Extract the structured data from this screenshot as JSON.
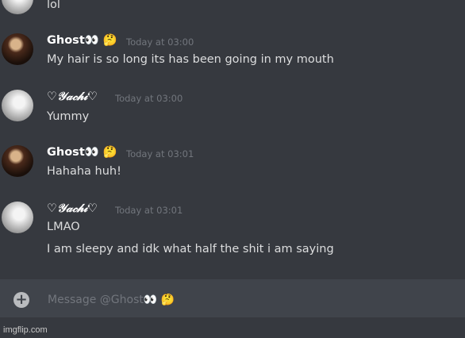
{
  "top_partial": {
    "text": "lol"
  },
  "messages": [
    {
      "username": "Ghost👀 🤔",
      "timestamp": "Today at 03:00",
      "lines": [
        "My hair is so long its has been going in my mouth"
      ]
    },
    {
      "username": "♡𝒴𝒶𝒸𝒽𝒾♡",
      "timestamp": "Today at 03:00",
      "lines": [
        "Yummy"
      ]
    },
    {
      "username": "Ghost👀 🤔",
      "timestamp": "Today at 03:01",
      "lines": [
        "Hahaha huh!"
      ]
    },
    {
      "username": "♡𝒴𝒶𝒸𝒽𝒾♡",
      "timestamp": "Today at 03:01",
      "lines": [
        "LMAO",
        "I am sleepy and idk what half the shit i am saying"
      ]
    }
  ],
  "composer": {
    "placeholder": "Message @Ghost👀 🤔",
    "add_icon": "plus-circle-icon"
  },
  "watermark": "imgflip.com",
  "colors": {
    "background": "#36393f",
    "composer": "#40444b",
    "text": "#dcddde",
    "muted": "#72767d"
  }
}
